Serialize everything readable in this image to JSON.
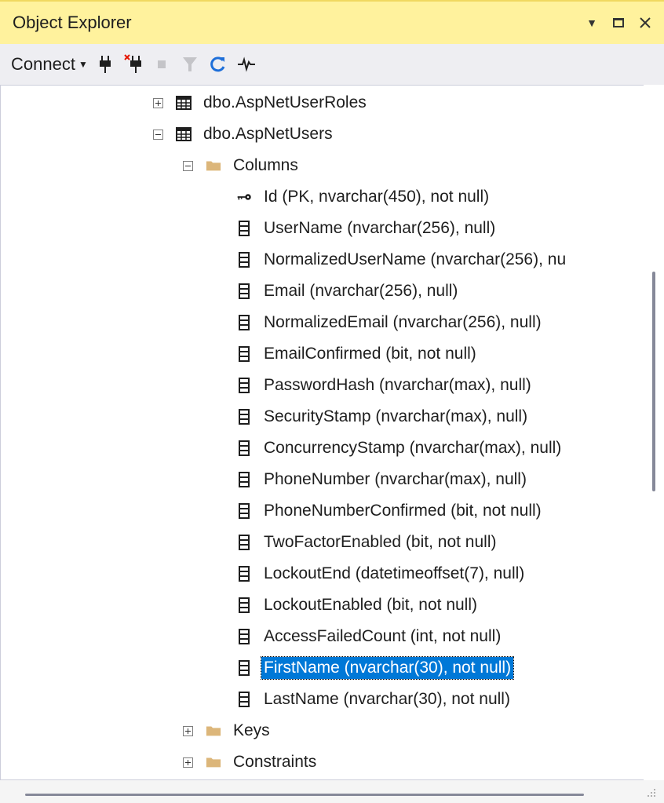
{
  "window": {
    "title": "Object Explorer"
  },
  "titlebar_buttons": [
    "window-position-dropdown",
    "maximize",
    "close"
  ],
  "toolbar": {
    "connect_label": "Connect",
    "icons": [
      "connect-plug-icon",
      "disconnect-plug-icon",
      "stop-icon",
      "filter-icon",
      "refresh-icon",
      "activity-monitor-icon"
    ]
  },
  "tree": {
    "table_roles": "dbo.AspNetUserRoles",
    "table_users": "dbo.AspNetUsers",
    "folder_columns": "Columns",
    "columns": [
      "Id (PK, nvarchar(450), not null)",
      "UserName (nvarchar(256), null)",
      "NormalizedUserName (nvarchar(256), nu",
      "Email (nvarchar(256), null)",
      "NormalizedEmail (nvarchar(256), null)",
      "EmailConfirmed (bit, not null)",
      "PasswordHash (nvarchar(max), null)",
      "SecurityStamp (nvarchar(max), null)",
      "ConcurrencyStamp (nvarchar(max), null)",
      "PhoneNumber (nvarchar(max), null)",
      "PhoneNumberConfirmed (bit, not null)",
      "TwoFactorEnabled (bit, not null)",
      "LockoutEnd (datetimeoffset(7), null)",
      "LockoutEnabled (bit, not null)",
      "AccessFailedCount (int, not null)",
      "FirstName (nvarchar(30), not null)",
      "LastName (nvarchar(30), not null)"
    ],
    "selected_column": "FirstName (nvarchar(30), not null)",
    "folder_keys": "Keys",
    "folder_constraints": "Constraints"
  },
  "colors": {
    "titlebar": "#fff29d",
    "toolbar": "#eeeef2",
    "selection": "#0078d7",
    "folder": "#dcb67a",
    "plug_icon": "#1e1e1e",
    "disconnect_x": "#e51400",
    "refresh": "#1e6fd9"
  }
}
